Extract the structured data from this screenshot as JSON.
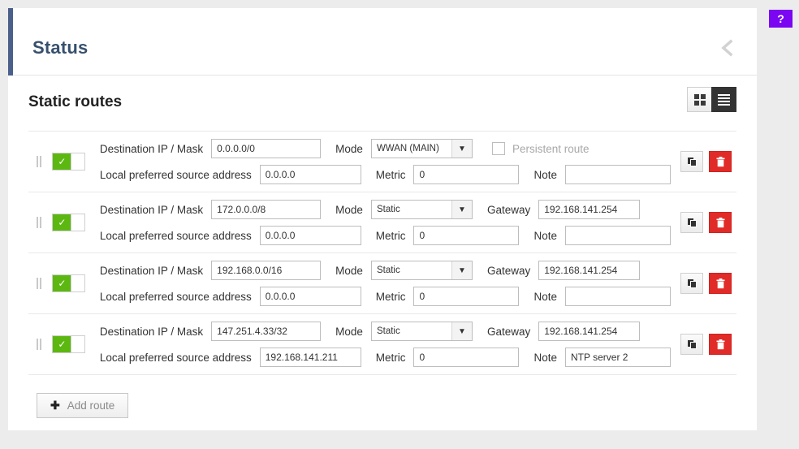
{
  "header": {
    "title": "Status",
    "collapse_icon": "chevron-left-icon",
    "accent_color": "#4a5f8a"
  },
  "help_badge": {
    "label": "?",
    "color": "#7a06f2"
  },
  "section": {
    "title": "Static routes",
    "view_toggle": {
      "grid_label": "grid-view",
      "list_label": "list-view",
      "active": "list"
    }
  },
  "labels": {
    "destination": "Destination IP / Mask",
    "mode": "Mode",
    "gateway": "Gateway",
    "persistent": "Persistent route",
    "local_source": "Local preferred source address",
    "metric": "Metric",
    "note": "Note",
    "toggle_check": "✓",
    "copy_icon": "copy-icon",
    "delete_icon": "trash-icon"
  },
  "routes": [
    {
      "enabled": true,
      "destination": "0.0.0.0/0",
      "mode": "WWAN (MAIN)",
      "third_field": "persistent",
      "persistent_checked": false,
      "local_source": "0.0.0.0",
      "metric": "0",
      "note": ""
    },
    {
      "enabled": true,
      "destination": "172.0.0.0/8",
      "mode": "Static",
      "third_field": "gateway",
      "gateway": "192.168.141.254",
      "local_source": "0.0.0.0",
      "metric": "0",
      "note": ""
    },
    {
      "enabled": true,
      "destination": "192.168.0.0/16",
      "mode": "Static",
      "third_field": "gateway",
      "gateway": "192.168.141.254",
      "local_source": "0.0.0.0",
      "metric": "0",
      "note": ""
    },
    {
      "enabled": true,
      "destination": "147.251.4.33/32",
      "mode": "Static",
      "third_field": "gateway",
      "gateway": "192.168.141.254",
      "local_source": "192.168.141.211",
      "metric": "0",
      "note": "NTP server 2"
    }
  ],
  "add_button": {
    "label": "Add route",
    "plus": "✚"
  }
}
